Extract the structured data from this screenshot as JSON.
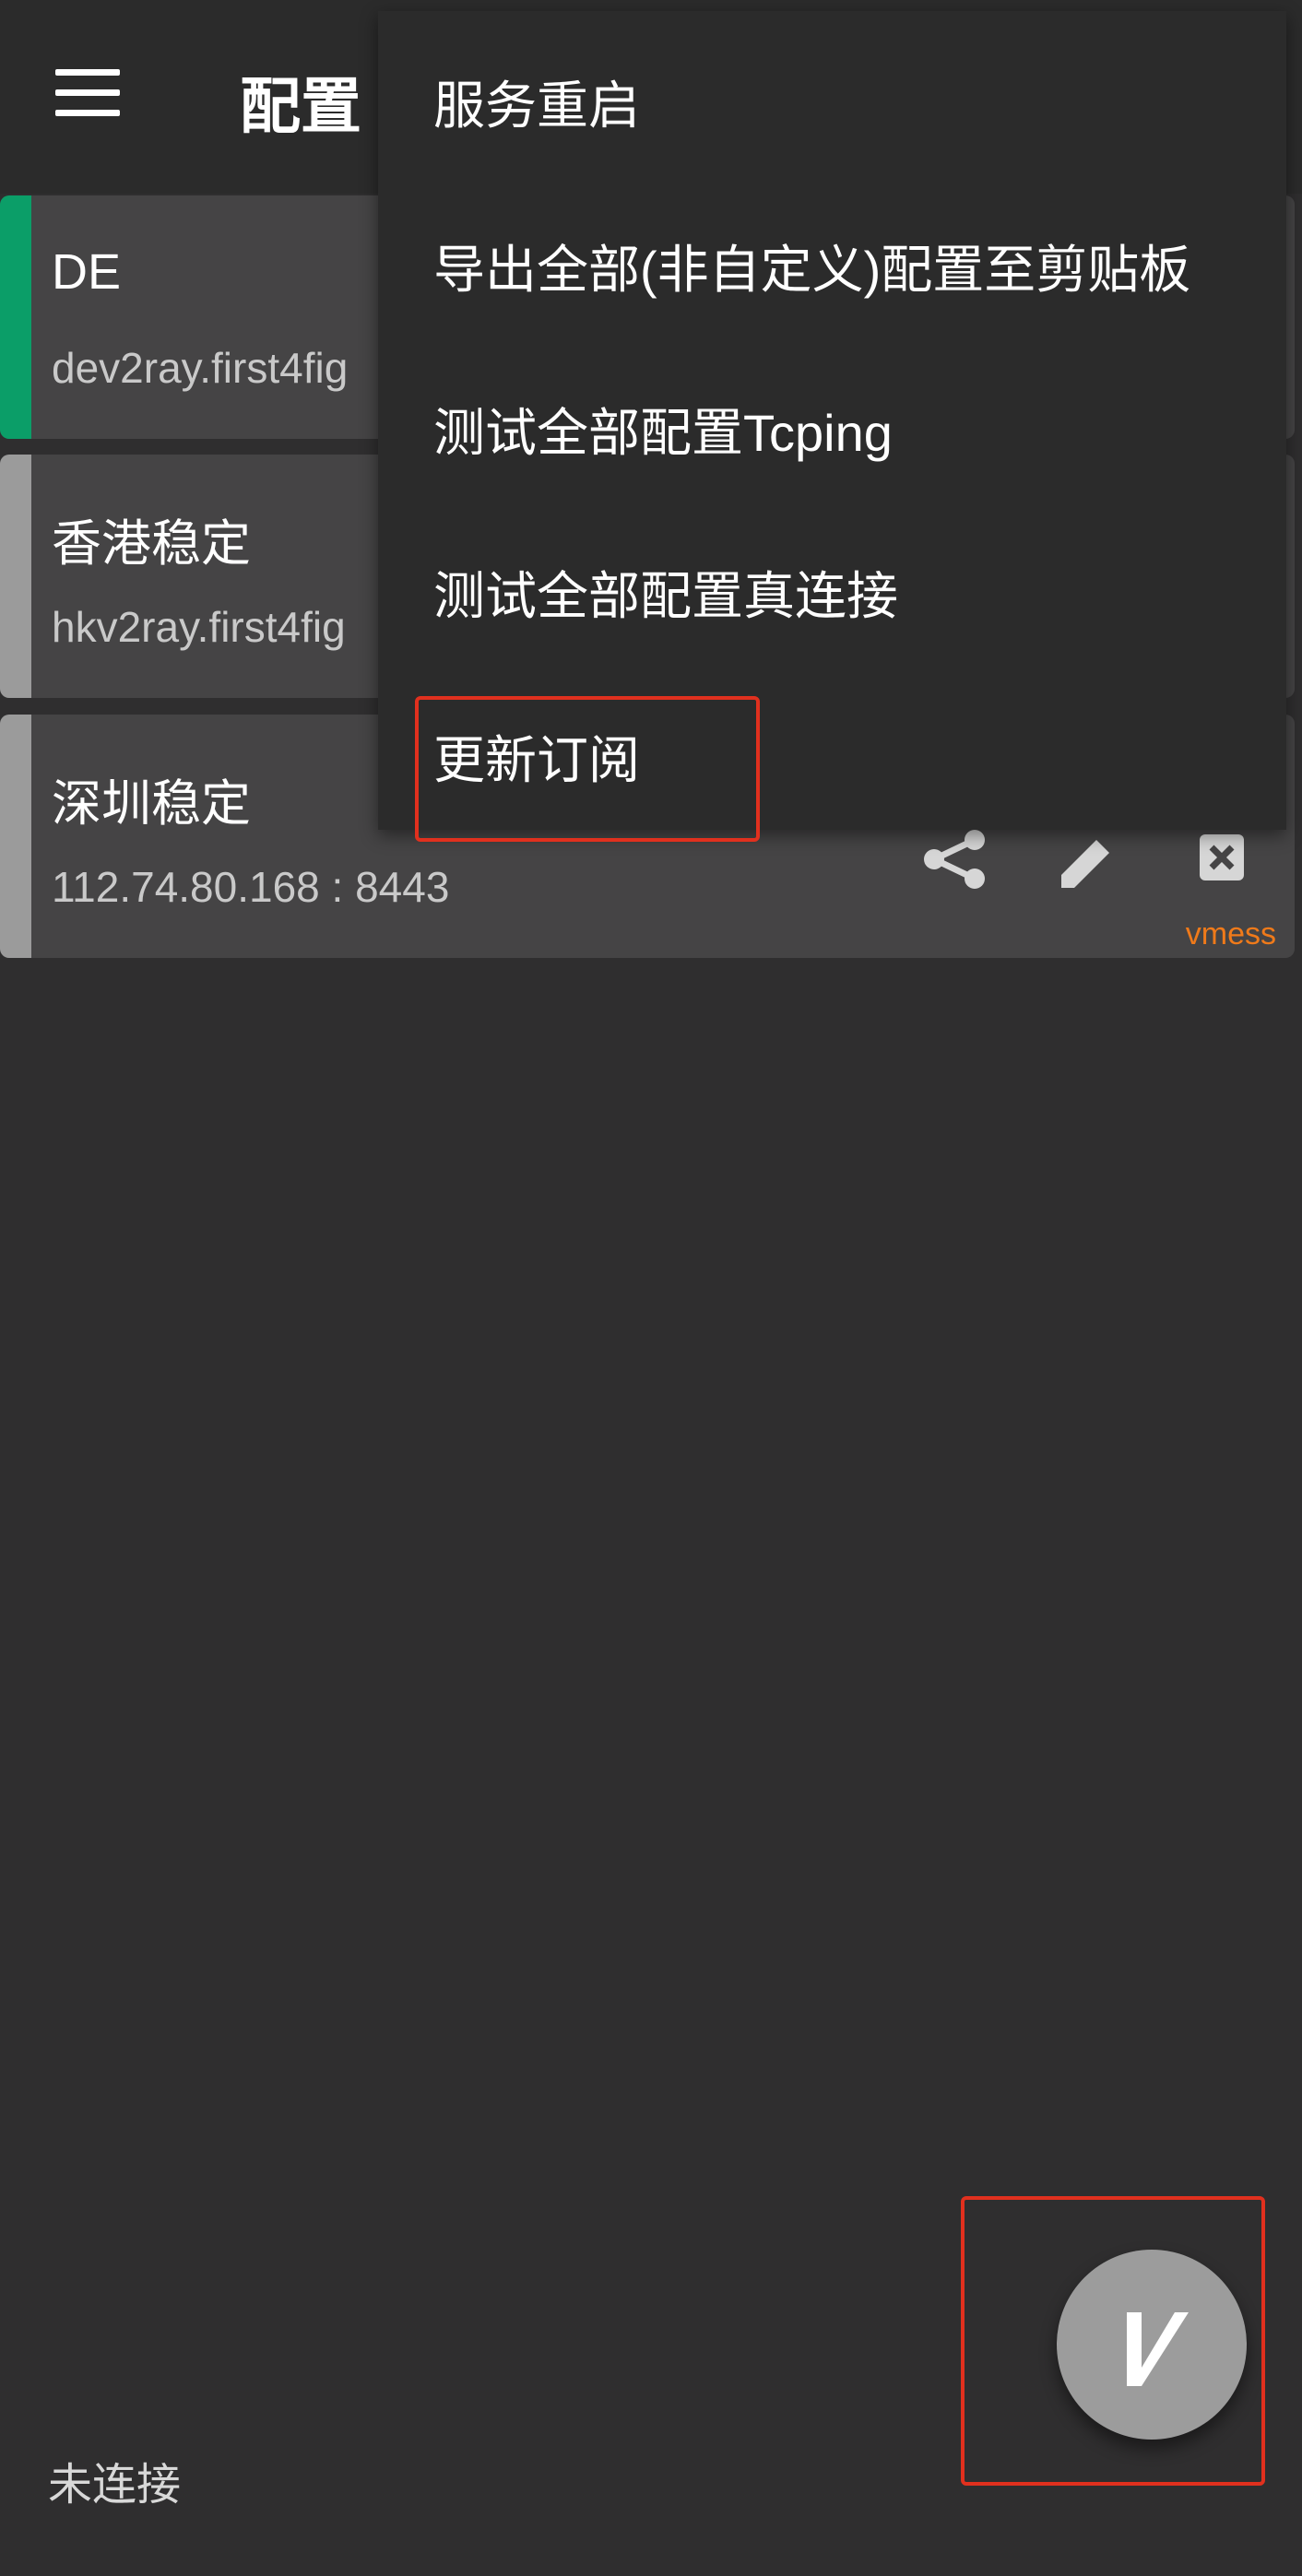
{
  "toolbar": {
    "title": "配置"
  },
  "servers": [
    {
      "name": "DE",
      "address": "dev2ray.first4fig",
      "active": true,
      "protocol": ""
    },
    {
      "name": "香港稳定",
      "address": "hkv2ray.first4fig",
      "active": false,
      "protocol": ""
    },
    {
      "name": "深圳稳定",
      "address": "112.74.80.168 : 8443",
      "active": false,
      "protocol": "vmess"
    }
  ],
  "menu": {
    "items": [
      {
        "label": "服务重启"
      },
      {
        "label": "导出全部(非自定义)配置至剪贴板"
      },
      {
        "label": "测试全部配置Tcping"
      },
      {
        "label": "测试全部配置真连接"
      },
      {
        "label": "更新订阅"
      }
    ]
  },
  "fab": {
    "icon": "v-logo-icon"
  },
  "status": {
    "text": "未连接"
  },
  "colors": {
    "background": "#2f2e2f",
    "card": "#454445",
    "active_stripe": "#0b9e68",
    "inactive_stripe": "#9b9b9b",
    "protocol": "#ef7a1a",
    "highlight": "#e1301e"
  }
}
